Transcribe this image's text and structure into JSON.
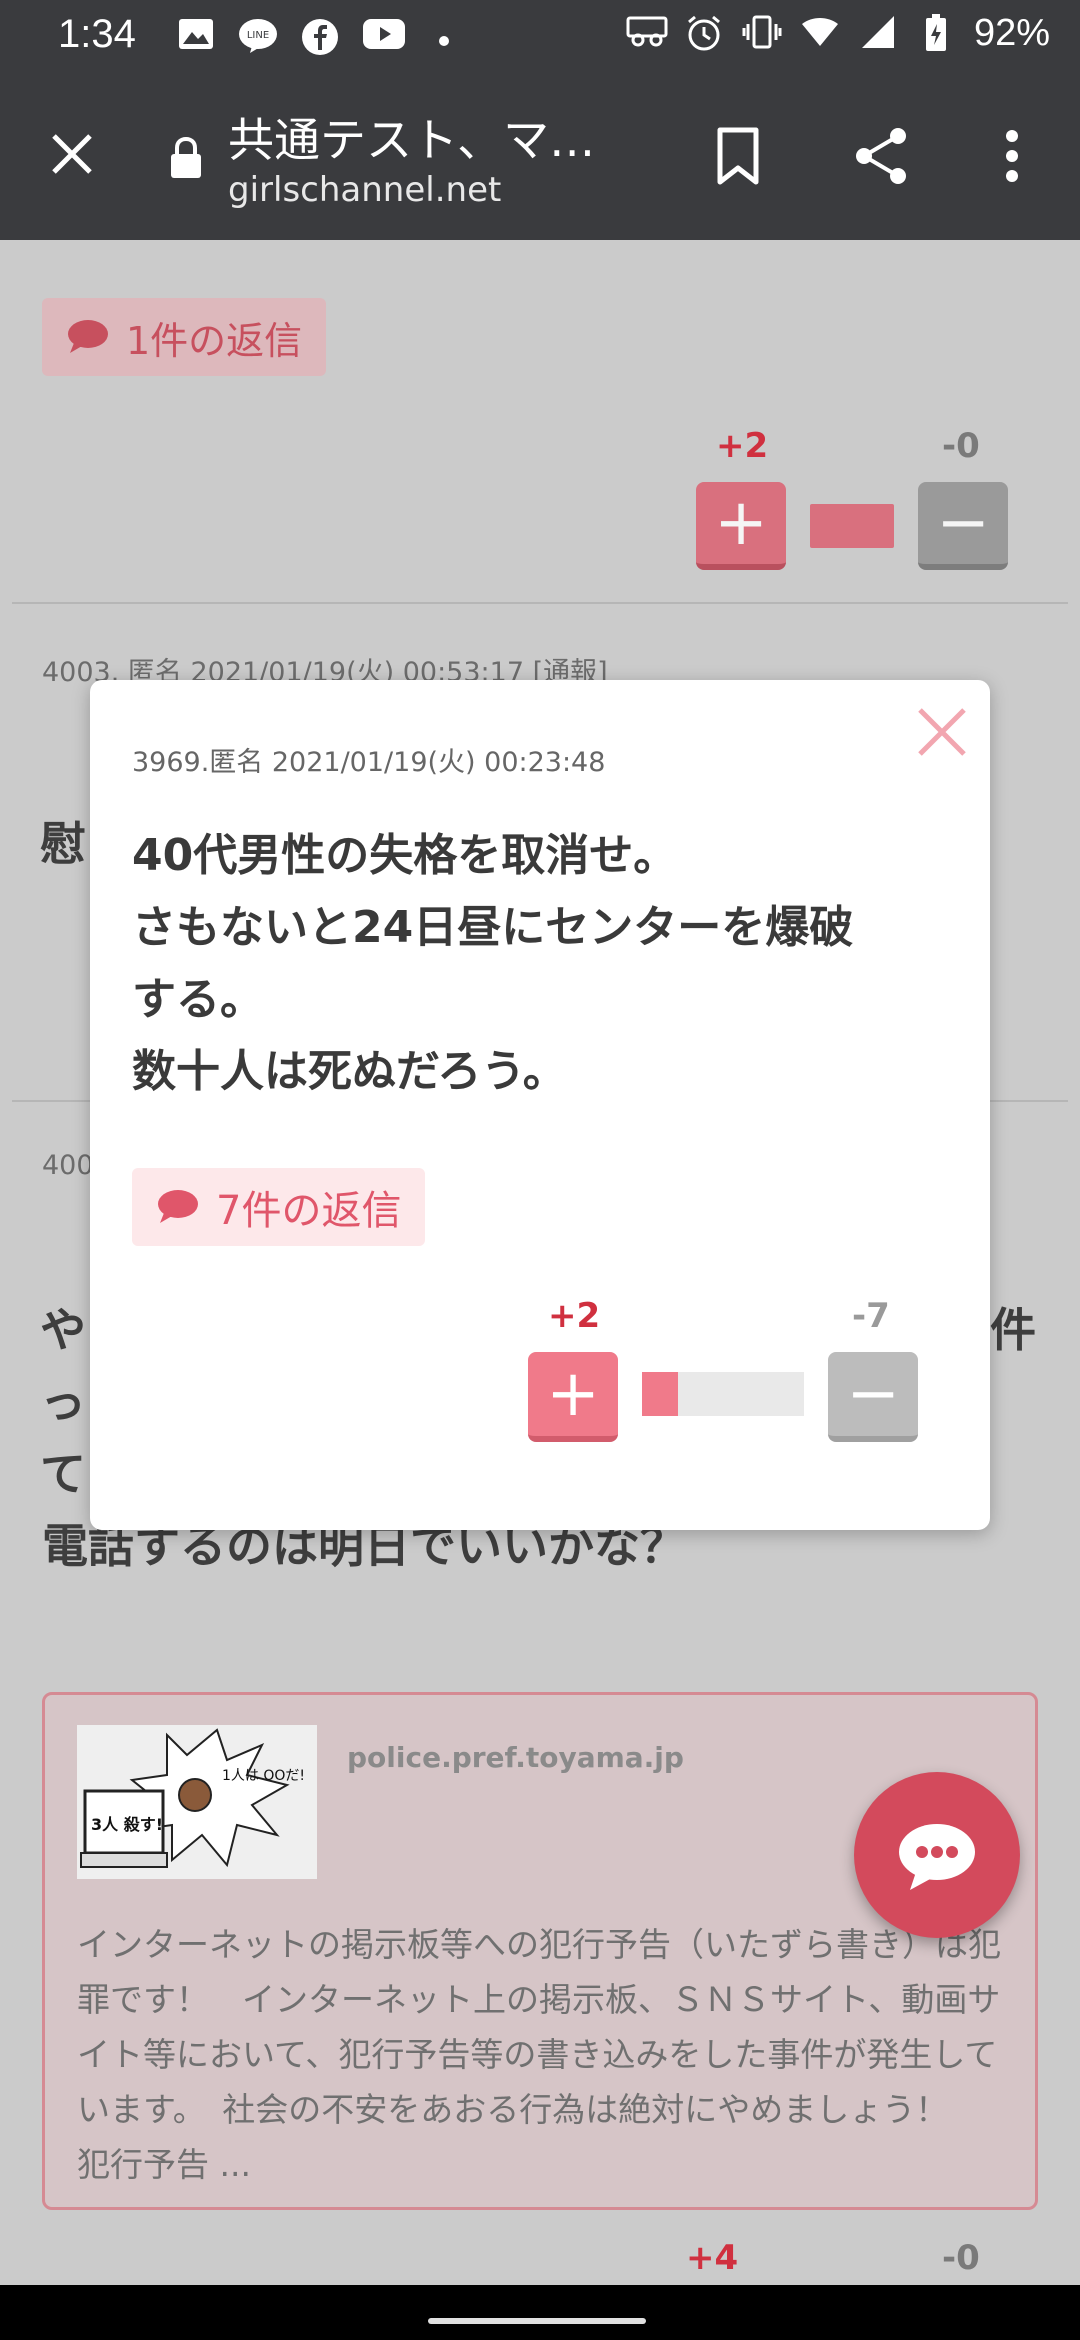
{
  "status_bar": {
    "time": "1:34",
    "battery": "92%",
    "left_icons": [
      "image-icon",
      "line-icon",
      "facebook-icon",
      "youtube-icon",
      "dot-icon"
    ],
    "right_icons": [
      "voicemail-icon",
      "alarm-icon",
      "vibrate-icon",
      "wifi-icon",
      "signal-icon",
      "battery-icon"
    ]
  },
  "toolbar": {
    "title": "共通テスト、マ…",
    "url": "girlschannel.net"
  },
  "background": {
    "reply_chip_1": "1件の返信",
    "vote_1_plus": "+2",
    "vote_1_minus": "-0",
    "vote_1_ratio": 1.0,
    "comment_meta": "4003. 匿名 2021/01/19(火) 00:53:17 [通報]",
    "fragment_1": "慰",
    "fragment_2": "400",
    "fragment_3a": "や",
    "fragment_3b": "件",
    "fragment_4": "っ",
    "fragment_5": "て",
    "comment_line": "電話するのは明日でいいかな？",
    "link_card": {
      "domain": "police.pref.toyama.jp",
      "thumb_text_1": "1人は OOだ!",
      "thumb_text_2": "3人 殺す!",
      "description": "インターネットの掲示板等への犯行予告（いたずら書き）は犯罪です！　インターネット上の掲示板、ＳＮＳサイト、動画サイト等において、犯行予告等の書き込みをした事件が発生しています。　社会の不安をあおる行為は絶対にやめましょう！　　犯行予告 ..."
    },
    "vote_2_plus": "+4",
    "vote_2_minus": "-0"
  },
  "modal": {
    "meta": "3969.匿名 2021/01/19(火) 00:23:48",
    "body_lines": [
      "40代男性の失格を取消せ。",
      "さもないと24日昼にセンターを爆破",
      "する。",
      "数十人は死ぬだろう。"
    ],
    "reply_chip": "7件の返信",
    "vote_plus": "+2",
    "vote_minus": "-7",
    "vote_ratio": 0.22
  },
  "colors": {
    "toolbar": "#3a3b3e",
    "accent": "#e0566a",
    "plus_red": "#d0303f"
  }
}
